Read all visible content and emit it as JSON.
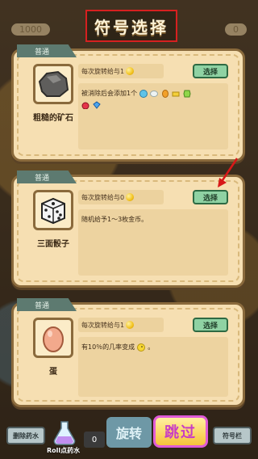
{
  "title": "符号选择",
  "topbar": {
    "left_value": "1000",
    "right_value": "0"
  },
  "cards": [
    {
      "rarity": "普通",
      "name": "粗糙的矿石",
      "icon": "rock-icon",
      "gain_text": "每次旋转给与1",
      "select_label": "选择",
      "desc_text": "被消除后会添加1个"
    },
    {
      "rarity": "普通",
      "name": "三面骰子",
      "icon": "dice-icon",
      "gain_text": "每次旋转给与0",
      "select_label": "选择",
      "desc_text": "随机给予1～3枚金币。"
    },
    {
      "rarity": "普通",
      "name": "蛋",
      "icon": "egg-icon",
      "gain_text": "每次旋转给与1",
      "select_label": "选择",
      "desc_text": "有10％的几率变成"
    }
  ],
  "bottom": {
    "remove_potion": "删除药水",
    "roll_potion": "Roll点药水",
    "roll_count": "0",
    "spin": "旋转",
    "skip": "跳过",
    "symbol_bar": "符号栏"
  },
  "colors": {
    "highlight_border": "#d62020",
    "card_bg": "#f6dfb2",
    "select_button": "#8fd2a3",
    "skip_border": "#e05bd8"
  }
}
